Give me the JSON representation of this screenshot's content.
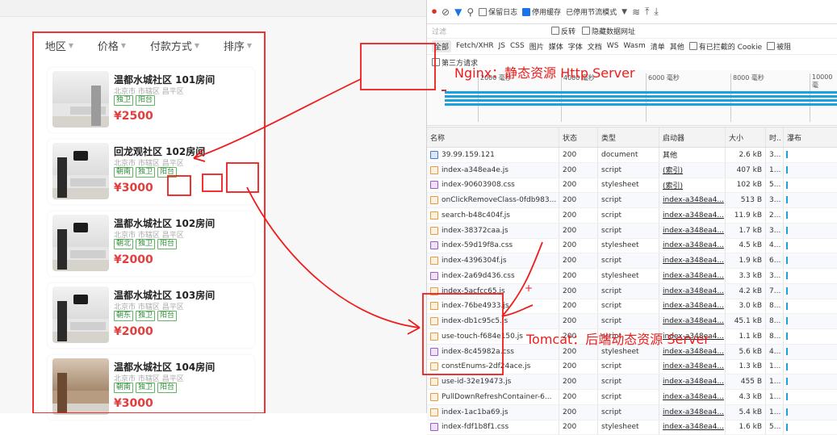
{
  "app": {
    "filters": [
      {
        "label": "地区"
      },
      {
        "label": "价格"
      },
      {
        "label": "付款方式"
      },
      {
        "label": "排序"
      }
    ],
    "houses": [
      {
        "title": "温都水城社区 101房间",
        "address": "北京市 市辖区 昌平区",
        "tags": [
          "独卫",
          "阳台"
        ],
        "price": "¥2500"
      },
      {
        "title": "回龙观社区 102房间",
        "address": "北京市 市辖区 昌平区",
        "tags": [
          "朝南",
          "独卫",
          "阳台"
        ],
        "price": "¥3000"
      },
      {
        "title": "温都水城社区 102房间",
        "address": "北京市 市辖区 昌平区",
        "tags": [
          "朝北",
          "独卫",
          "阳台"
        ],
        "price": "¥2000"
      },
      {
        "title": "温都水城社区 103房间",
        "address": "北京市 市辖区 昌平区",
        "tags": [
          "朝东",
          "独卫",
          "阳台"
        ],
        "price": "¥2000"
      },
      {
        "title": "温都水城社区 104房间",
        "address": "北京市 市辖区 昌平区",
        "tags": [
          "朝南",
          "独卫",
          "阳台"
        ],
        "price": "¥3000"
      }
    ]
  },
  "devtools": {
    "toolbar": {
      "preserve_log": "保留日志",
      "disable_cache": "停用缓存",
      "throttling": "已停用节流模式"
    },
    "filter": {
      "placeholder": "过滤",
      "invert": "反转",
      "hide_data_urls": "隐藏数据网址"
    },
    "types": [
      "全部",
      "Fetch/XHR",
      "JS",
      "CSS",
      "图片",
      "媒体",
      "字体",
      "文档",
      "WS",
      "Wasm",
      "清单",
      "其他"
    ],
    "blocked_cookies": "有已拦截的 Cookie",
    "blocked_requests": "被阻",
    "third_party": "第三方请求",
    "timeline_ticks": [
      "2000 毫秒",
      "4000 毫秒",
      "6000 毫秒",
      "8000 毫秒",
      "10000 毫"
    ],
    "columns": {
      "name": "名称",
      "status": "状态",
      "type": "类型",
      "initiator": "启动器",
      "size": "大小",
      "time": "时..",
      "waterfall": "瀑布"
    },
    "rows": [
      {
        "name": "39.99.159.121",
        "status": "200",
        "type": "document",
        "initiator": "其他",
        "size": "2.6 kB",
        "time": "3...",
        "kind": "doc"
      },
      {
        "name": "index-a348ea4e.js",
        "status": "200",
        "type": "script",
        "initiator": "(索引)",
        "size": "407 kB",
        "time": "1...",
        "kind": "js"
      },
      {
        "name": "index-90603908.css",
        "status": "200",
        "type": "stylesheet",
        "initiator": "(索引)",
        "size": "102 kB",
        "time": "5...",
        "kind": "css"
      },
      {
        "name": "onClickRemoveClass-0fdb983...",
        "status": "200",
        "type": "script",
        "initiator": "index-a348ea4...",
        "size": "513 B",
        "time": "3...",
        "kind": "js"
      },
      {
        "name": "search-b48c404f.js",
        "status": "200",
        "type": "script",
        "initiator": "index-a348ea4...",
        "size": "11.9 kB",
        "time": "2...",
        "kind": "js"
      },
      {
        "name": "index-38372caa.js",
        "status": "200",
        "type": "script",
        "initiator": "index-a348ea4...",
        "size": "1.7 kB",
        "time": "3...",
        "kind": "js"
      },
      {
        "name": "index-59d19f8a.css",
        "status": "200",
        "type": "stylesheet",
        "initiator": "index-a348ea4...",
        "size": "4.5 kB",
        "time": "4...",
        "kind": "css"
      },
      {
        "name": "index-4396304f.js",
        "status": "200",
        "type": "script",
        "initiator": "index-a348ea4...",
        "size": "1.9 kB",
        "time": "6...",
        "kind": "js"
      },
      {
        "name": "index-2a69d436.css",
        "status": "200",
        "type": "stylesheet",
        "initiator": "index-a348ea4...",
        "size": "3.3 kB",
        "time": "3...",
        "kind": "css"
      },
      {
        "name": "index-5acfcc65.js",
        "status": "200",
        "type": "script",
        "initiator": "index-a348ea4...",
        "size": "4.2 kB",
        "time": "7...",
        "kind": "js"
      },
      {
        "name": "index-76be4933.js",
        "status": "200",
        "type": "script",
        "initiator": "index-a348ea4...",
        "size": "3.0 kB",
        "time": "8...",
        "kind": "js"
      },
      {
        "name": "index-db1c95c5.js",
        "status": "200",
        "type": "script",
        "initiator": "index-a348ea4...",
        "size": "45.1 kB",
        "time": "8...",
        "kind": "js"
      },
      {
        "name": "use-touch-f684e150.js",
        "status": "200",
        "type": "script",
        "initiator": "index-a348ea4...",
        "size": "1.1 kB",
        "time": "8...",
        "kind": "js"
      },
      {
        "name": "index-8c45982a.css",
        "status": "200",
        "type": "stylesheet",
        "initiator": "index-a348ea4...",
        "size": "5.6 kB",
        "time": "4...",
        "kind": "css"
      },
      {
        "name": "constEnums-2df24ace.js",
        "status": "200",
        "type": "script",
        "initiator": "index-a348ea4...",
        "size": "1.3 kB",
        "time": "1...",
        "kind": "js"
      },
      {
        "name": "use-id-32e19473.js",
        "status": "200",
        "type": "script",
        "initiator": "index-a348ea4...",
        "size": "455 B",
        "time": "1...",
        "kind": "js"
      },
      {
        "name": "PullDownRefreshContainer-6...",
        "status": "200",
        "type": "script",
        "initiator": "index-a348ea4...",
        "size": "4.3 kB",
        "time": "1...",
        "kind": "js"
      },
      {
        "name": "index-1ac1ba69.js",
        "status": "200",
        "type": "script",
        "initiator": "index-a348ea4...",
        "size": "5.4 kB",
        "time": "1...",
        "kind": "js"
      },
      {
        "name": "index-fdf1b8f1.css",
        "status": "200",
        "type": "stylesheet",
        "initiator": "index-a348ea4...",
        "size": "1.6 kB",
        "time": "5...",
        "kind": "css"
      }
    ]
  },
  "annotations": {
    "nginx": "Nginx：静态资源 Http Server",
    "tomcat": "Tomcat：后端动态资源 Server",
    "plus": "+",
    "color": "#ee1c1c"
  },
  "colors": {
    "price": "#e23e3e",
    "tag": "#2e8b3a",
    "accent": "#1a73e8",
    "record": "#d93025",
    "waterfall": "#1aa1e0"
  }
}
